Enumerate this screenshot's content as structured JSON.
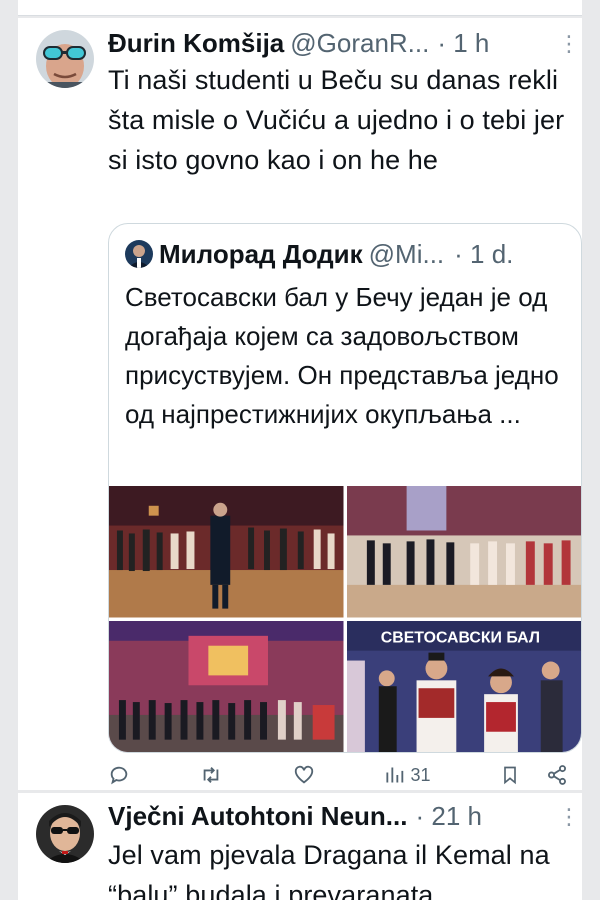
{
  "tweet1": {
    "author_name": "Đurin Komšija",
    "handle": "@GoranR...",
    "time": "· 1 h",
    "more": "⋮",
    "text": "Ti naši studenti u Beču su danas rekli šta misle o Vučiću a ujedno i o tebi jer si isto govno kao i on he he",
    "quote": {
      "author_name": "Милорад Додик",
      "handle": "@Mi...",
      "time": "· 1 d.",
      "text": "Светосавски бал у Бечу један је од догађаја којем са задовољством присуствујем. Он представља једно од најпрестижнијих окупљања ...",
      "banner_text": "СВЕТОСАВСКИ БАЛ"
    },
    "actions": {
      "reply_icon": "reply-icon",
      "retweet_icon": "retweet-icon",
      "like_icon": "heart-icon",
      "views_icon": "views-icon",
      "views_count": "31",
      "bookmark_icon": "bookmark-icon",
      "share_icon": "share-icon"
    }
  },
  "tweet2": {
    "author_name": "Vječni Autohtoni Neun...",
    "time": "· 21 h",
    "more": "⋮",
    "text": "Jel vam pjevala Dragana il Kemal na “balu” budala i prevaranata"
  },
  "colors": {
    "text": "#0f1419",
    "secondary": "#536471",
    "border": "#cfd9de",
    "background": "#e8e9eb"
  }
}
